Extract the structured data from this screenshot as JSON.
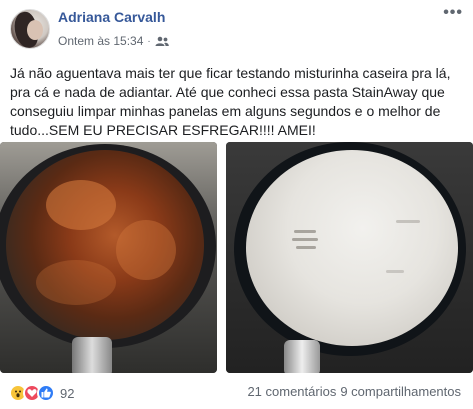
{
  "post": {
    "author": "Adriana Carvalh",
    "timestamp": "Ontem às 15:34",
    "separator": "·",
    "audience_icon": "friends-icon",
    "more_label": "•••",
    "text": "Já não aguentava mais ter que ficar testando misturinha caseira pra lá, pra cá e nada de adiantar. Até que conheci essa pasta StainAway que conseguiu limpar minhas panelas em alguns segundos e o melhor de tudo...SEM EU PRECISAR ESFREGAR!!!! AMEI!"
  },
  "reactions": {
    "icons": [
      "wow-icon",
      "love-icon",
      "like-icon"
    ],
    "count": "92"
  },
  "stats": {
    "comments": "21 comentários",
    "shares": "9 compartilhamentos"
  },
  "colors": {
    "author_link": "#365899",
    "secondary_text": "#606770",
    "like_blue": "#2f7cf6",
    "love_red": "#ed4a5e",
    "wow_yellow": "#f7c43a"
  }
}
